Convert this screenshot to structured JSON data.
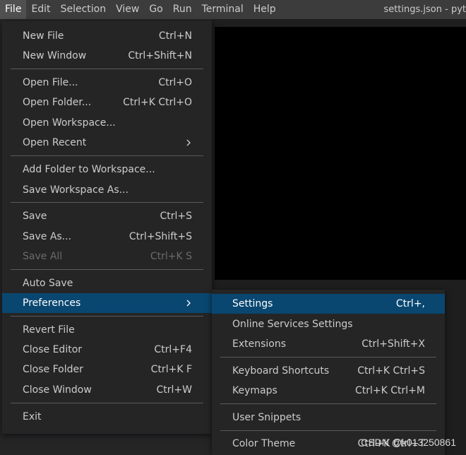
{
  "menubar": {
    "items": [
      "File",
      "Edit",
      "Selection",
      "View",
      "Go",
      "Run",
      "Terminal",
      "Help"
    ],
    "window_title": "settings.json - pyt"
  },
  "file_menu": {
    "new_file": {
      "label": "New File",
      "shortcut": "Ctrl+N"
    },
    "new_window": {
      "label": "New Window",
      "shortcut": "Ctrl+Shift+N"
    },
    "open_file": {
      "label": "Open File...",
      "shortcut": "Ctrl+O"
    },
    "open_folder": {
      "label": "Open Folder...",
      "shortcut": "Ctrl+K Ctrl+O"
    },
    "open_workspace": {
      "label": "Open Workspace..."
    },
    "open_recent": {
      "label": "Open Recent"
    },
    "add_folder": {
      "label": "Add Folder to Workspace..."
    },
    "save_workspace_as": {
      "label": "Save Workspace As..."
    },
    "save": {
      "label": "Save",
      "shortcut": "Ctrl+S"
    },
    "save_as": {
      "label": "Save As...",
      "shortcut": "Ctrl+Shift+S"
    },
    "save_all": {
      "label": "Save All",
      "shortcut": "Ctrl+K S"
    },
    "auto_save": {
      "label": "Auto Save"
    },
    "preferences": {
      "label": "Preferences"
    },
    "revert_file": {
      "label": "Revert File"
    },
    "close_editor": {
      "label": "Close Editor",
      "shortcut": "Ctrl+F4"
    },
    "close_folder": {
      "label": "Close Folder",
      "shortcut": "Ctrl+K F"
    },
    "close_window": {
      "label": "Close Window",
      "shortcut": "Ctrl+W"
    },
    "exit": {
      "label": "Exit"
    }
  },
  "pref_menu": {
    "settings": {
      "label": "Settings",
      "shortcut": "Ctrl+,"
    },
    "online_services": {
      "label": "Online Services Settings"
    },
    "extensions": {
      "label": "Extensions",
      "shortcut": "Ctrl+Shift+X"
    },
    "keyboard_shortcuts": {
      "label": "Keyboard Shortcuts",
      "shortcut": "Ctrl+K Ctrl+S"
    },
    "keymaps": {
      "label": "Keymaps",
      "shortcut": "Ctrl+K Ctrl+M"
    },
    "user_snippets": {
      "label": "User Snippets"
    },
    "color_theme": {
      "label": "Color Theme",
      "shortcut": "Ctrl+K Ctrl+T"
    }
  },
  "watermark": "CSDN @k013250861",
  "colors": {
    "selection": "#094771",
    "menu_bg": "#252526",
    "menubar_bg": "#3c3c3c"
  }
}
